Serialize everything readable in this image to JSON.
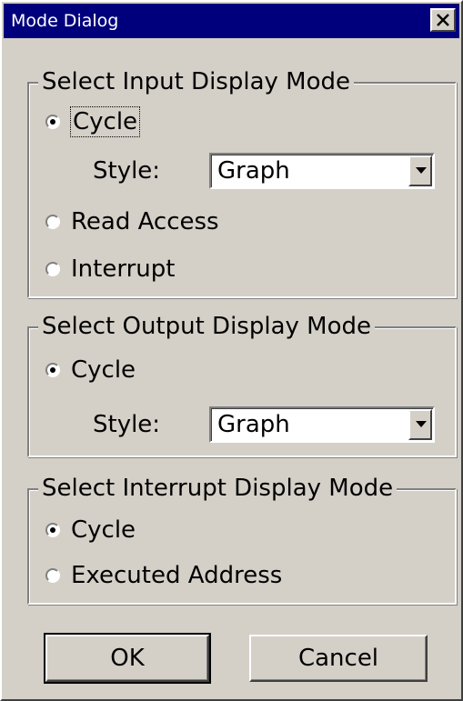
{
  "window": {
    "title": "Mode Dialog"
  },
  "input_group": {
    "legend": "Select Input Display Mode",
    "options": [
      "Cycle",
      "Read Access",
      "Interrupt"
    ],
    "selected": "Cycle",
    "style_label": "Style:",
    "style_value": "Graph"
  },
  "output_group": {
    "legend": "Select Output Display Mode",
    "options": [
      "Cycle"
    ],
    "selected": "Cycle",
    "style_label": "Style:",
    "style_value": "Graph"
  },
  "interrupt_group": {
    "legend": "Select Interrupt Display Mode",
    "options": [
      "Cycle",
      "Executed Address"
    ],
    "selected": "Cycle"
  },
  "buttons": {
    "ok": "OK",
    "cancel": "Cancel"
  },
  "icons": {
    "close": "close-icon",
    "dropdown": "chevron-down-icon"
  },
  "colors": {
    "titlebar": "#00007c",
    "face": "#d4d0c8"
  }
}
